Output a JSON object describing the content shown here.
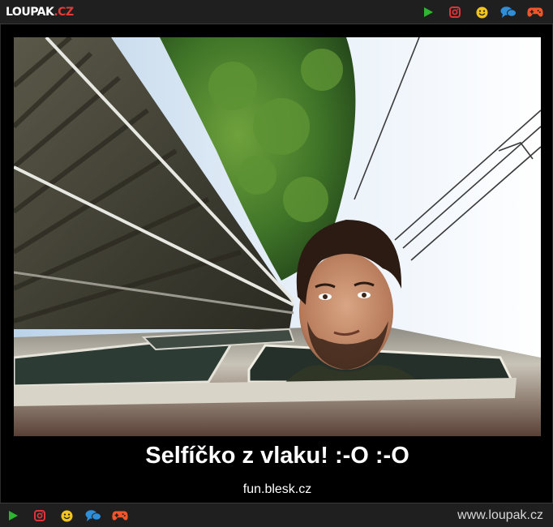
{
  "header": {
    "logo_part1": "LOUPAK",
    "logo_part2": ".CZ",
    "icons": [
      "play-icon",
      "instagram-icon",
      "smiley-icon",
      "chat-icon",
      "gamepad-icon"
    ]
  },
  "post": {
    "caption": "Selfíčko z vlaku! :-O :-O",
    "source": "fun.blesk.cz"
  },
  "footer": {
    "icons": [
      "play-icon",
      "instagram-icon",
      "smiley-icon",
      "chat-icon",
      "gamepad-icon"
    ],
    "site_url": "www.loupak.cz"
  },
  "colors": {
    "play": "#2fb52f",
    "instagram": "#e0323a",
    "smiley": "#f2c51c",
    "chat": "#2e8fd8",
    "gamepad": "#f0562a",
    "logo_accent": "#e03a3a"
  }
}
